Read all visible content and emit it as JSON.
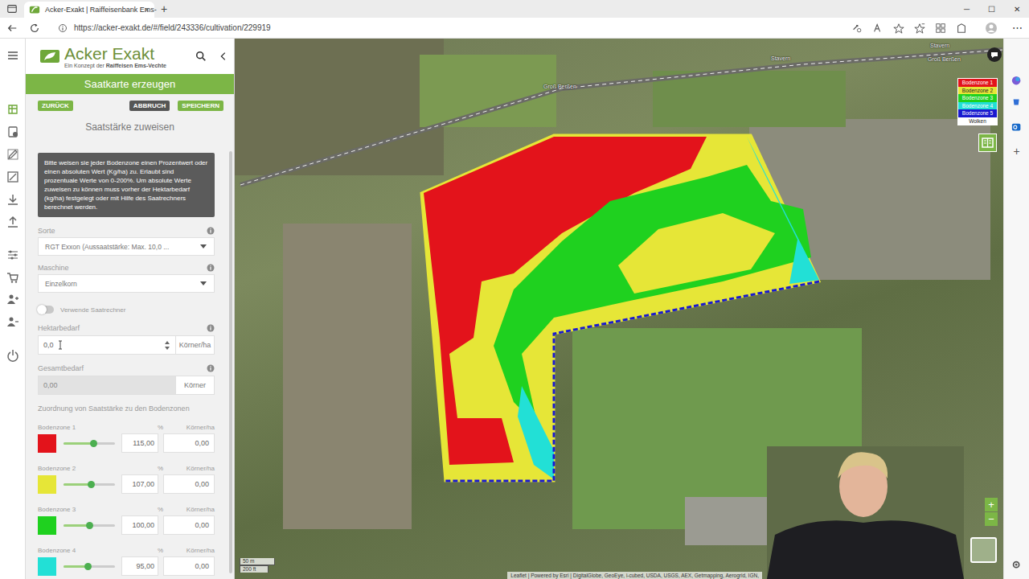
{
  "browser": {
    "tab": {
      "title": "Acker-Exakt | Raiffeisenbank Ems-",
      "close": "×",
      "selected": true
    },
    "new_tab": "+",
    "window_controls": [
      "─",
      "☐",
      "✕"
    ],
    "url": "https://acker-exakt.de/#/field/243336/cultivation/229919",
    "menu": "⋯",
    "sidebar_add": "+"
  },
  "rail": [
    {
      "selected": true
    },
    {
      "selected": false
    },
    {
      "selected": false
    },
    {
      "selected": false
    },
    {
      "selected": false
    },
    {
      "selected": false
    },
    {
      "selected": false
    },
    {
      "selected": false
    },
    {
      "selected": false
    },
    {
      "selected": false
    },
    {
      "selected": false
    }
  ],
  "app": {
    "logo": {
      "title": "Acker Exakt",
      "tagline": "Ein Konzept der",
      "brand": "Raiffeisen Ems-Vechte"
    },
    "header": "Saatkarte erzeugen",
    "buttons": [
      {
        "label": "ZURÜCK",
        "kind": "primary"
      },
      {
        "label": "ABBRUCH",
        "kind": "secondary"
      },
      {
        "label": "SPEICHERN",
        "kind": "primary"
      }
    ],
    "section_title": "Saatstärke zuweisen",
    "info": "Bitte weisen sie jeder Bodenzone einen Prozentwert oder einen absoluten Wert (Kg/ha) zu. Erlaubt sind prozentuale Werte von 0-200%. Um absolute Werte zuweisen zu können muss vorher der Hektarbedarf (kg/ha) festgelegt oder mit Hilfe des Saatrechners berechnet werden.",
    "fields": {
      "sorte": {
        "label": "Sorte",
        "value": "RGT Exxon (Aussaatstärke: Max. 10,0 ..."
      },
      "maschine": {
        "label": "Maschine",
        "value": "Einzelkorn"
      },
      "saatrechner": {
        "label": "Verwende Saatrechner",
        "on": false
      },
      "hektarbedarf": {
        "label": "Hektarbedarf",
        "value": "0,0",
        "unit": "Körner/ha"
      },
      "gesamtbedarf": {
        "label": "Gesamtbedarf",
        "value": "0,00",
        "unit": "Körner",
        "disabled": true
      }
    },
    "zones_title": "Zuordnung von Saatstärke zu den Bodenzonen",
    "zones": [
      {
        "name": "Bodenzone 1",
        "percent_label": "%",
        "amount_label": "Körner/ha",
        "color": "#e3131b",
        "level": 0.575,
        "percent": "115,00",
        "amount": "0,00"
      },
      {
        "name": "Bodenzone 2",
        "percent_label": "%",
        "amount_label": "Körner/ha",
        "color": "#e6e637",
        "level": 0.535,
        "percent": "107,00",
        "amount": "0,00"
      },
      {
        "name": "Bodenzone 3",
        "percent_label": "%",
        "amount_label": "Körner/ha",
        "color": "#1fd11f",
        "level": 0.5,
        "percent": "100,00",
        "amount": "0,00"
      },
      {
        "name": "Bodenzone 4",
        "percent_label": "%",
        "amount_label": "Körner/ha",
        "color": "#22e0d6",
        "level": 0.475,
        "percent": "95,00",
        "amount": "0,00"
      }
    ]
  },
  "map": {
    "labels": [
      "Stavern",
      "Groß Berßen",
      "Stavern",
      "Groß Berßen"
    ],
    "legend": [
      {
        "label": "Bodenzone 1",
        "color": "#e3131b"
      },
      {
        "label": "Bodenzone 2",
        "color": "#e6e637"
      },
      {
        "label": "Bodenzone 3",
        "color": "#1fd11f"
      },
      {
        "label": "Bodenzone 4",
        "color": "#22e0d6"
      },
      {
        "label": "Bodenzone 5",
        "color": "#1a1acf"
      },
      {
        "label": "Wolken",
        "color": "#ffffff"
      }
    ],
    "zoom_in": "+",
    "zoom_out": "−",
    "scale": {
      "metric": "50 m",
      "imperial": "200 ft"
    },
    "attribution": "Leaflet | Powered by Esri | DigitalGlobe, GeoEye, i-cubed, USDA, USGS, AEX, Getmapping, Aerogrid, IGN,"
  }
}
